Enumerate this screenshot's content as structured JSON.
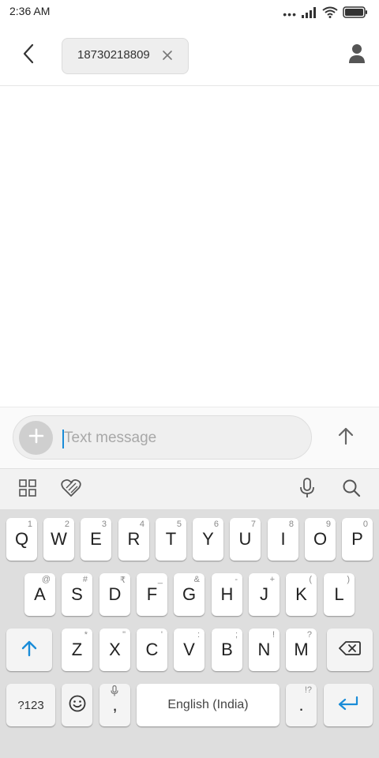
{
  "status_bar": {
    "time": "2:36 AM",
    "icons": [
      "more-dots-icon",
      "signal-icon",
      "wifi-icon",
      "battery-icon"
    ]
  },
  "header": {
    "back_icon": "chevron-left-icon",
    "recipient": "18730218809",
    "remove_icon": "close-icon",
    "contact_icon": "person-icon"
  },
  "compose": {
    "placeholder": "Text message",
    "value": "",
    "attach_icon": "plus-icon",
    "send_icon": "arrow-up-icon"
  },
  "keyboard_toolbar": {
    "left": [
      "grid-icon",
      "sticker-heart-icon"
    ],
    "right": [
      "microphone-icon",
      "search-icon"
    ]
  },
  "keyboard": {
    "row1": [
      {
        "main": "Q",
        "hint": "1"
      },
      {
        "main": "W",
        "hint": "2"
      },
      {
        "main": "E",
        "hint": "3"
      },
      {
        "main": "R",
        "hint": "4"
      },
      {
        "main": "T",
        "hint": "5"
      },
      {
        "main": "Y",
        "hint": "6"
      },
      {
        "main": "U",
        "hint": "7"
      },
      {
        "main": "I",
        "hint": "8"
      },
      {
        "main": "O",
        "hint": "9"
      },
      {
        "main": "P",
        "hint": "0"
      }
    ],
    "row2": [
      {
        "main": "A",
        "hint": "@"
      },
      {
        "main": "S",
        "hint": "#"
      },
      {
        "main": "D",
        "hint": "₹"
      },
      {
        "main": "F",
        "hint": "_"
      },
      {
        "main": "G",
        "hint": "&"
      },
      {
        "main": "H",
        "hint": "-"
      },
      {
        "main": "J",
        "hint": "+"
      },
      {
        "main": "K",
        "hint": "("
      },
      {
        "main": "L",
        "hint": ")"
      }
    ],
    "row3": [
      {
        "main": "Z",
        "hint": "*"
      },
      {
        "main": "X",
        "hint": "\""
      },
      {
        "main": "C",
        "hint": "'"
      },
      {
        "main": "V",
        "hint": ":"
      },
      {
        "main": "B",
        "hint": ";"
      },
      {
        "main": "N",
        "hint": "!"
      },
      {
        "main": "M",
        "hint": "?"
      }
    ],
    "symbols_label": "?123",
    "comma": ",",
    "space_label": "English (India)",
    "period": ".",
    "period_hint": "!?",
    "shift_icon": "shift-arrow-icon",
    "backspace_icon": "backspace-icon",
    "emoji_icon": "emoji-icon",
    "enter_icon": "enter-return-icon",
    "accent_color": "#1a8cd8"
  }
}
